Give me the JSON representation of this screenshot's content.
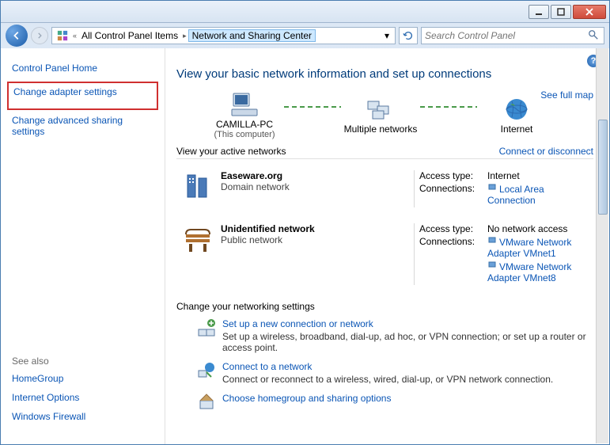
{
  "titlebar": {},
  "breadcrumb": {
    "prev": "All Control Panel Items",
    "current": "Network and Sharing Center"
  },
  "search": {
    "placeholder": "Search Control Panel"
  },
  "sidebar": {
    "home": "Control Panel Home",
    "change_adapter": "Change adapter settings",
    "change_advanced": "Change advanced sharing settings",
    "see_also": "See also",
    "homegroup": "HomeGroup",
    "internet_options": "Internet Options",
    "firewall": "Windows Firewall"
  },
  "main": {
    "heading": "View your basic network information and set up connections",
    "see_map": "See full map",
    "nodes": {
      "pc_name": "CAMILLA-PC",
      "pc_sub": "(This computer)",
      "multi": "Multiple networks",
      "internet": "Internet"
    },
    "active_head": "View your active networks",
    "connect_link": "Connect or disconnect",
    "net1": {
      "name": "Easeware.org",
      "type": "Domain network",
      "access_k": "Access type:",
      "access_v": "Internet",
      "conn_k": "Connections:",
      "conn_v": "Local Area Connection"
    },
    "net2": {
      "name": "Unidentified network",
      "type": "Public network",
      "access_k": "Access type:",
      "access_v": "No network access",
      "conn_k": "Connections:",
      "conn_v1": "VMware Network Adapter VMnet1",
      "conn_v2": "VMware Network Adapter VMnet8"
    },
    "tasks_head": "Change your networking settings",
    "task1": {
      "link": "Set up a new connection or network",
      "desc": "Set up a wireless, broadband, dial-up, ad hoc, or VPN connection; or set up a router or access point."
    },
    "task2": {
      "link": "Connect to a network",
      "desc": "Connect or reconnect to a wireless, wired, dial-up, or VPN network connection."
    },
    "task3": {
      "link": "Choose homegroup and sharing options"
    }
  }
}
